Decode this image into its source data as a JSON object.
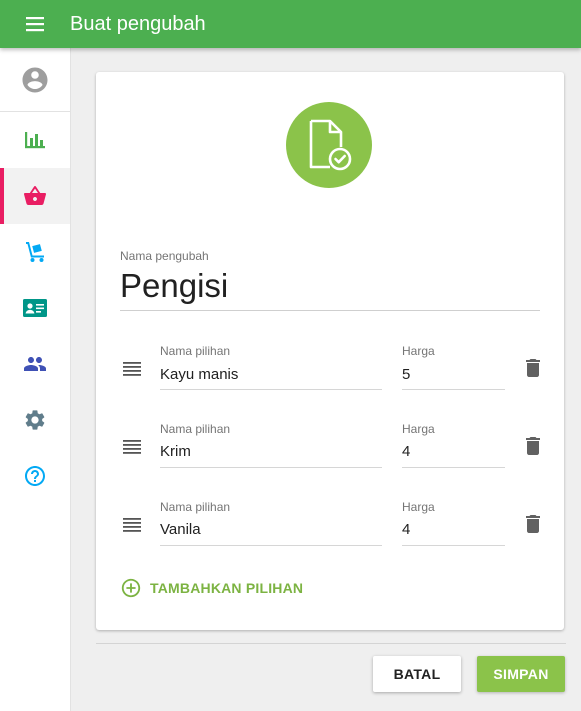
{
  "appbar": {
    "title": "Buat pengubah",
    "menu_icon": "hamburger-menu-icon"
  },
  "sidebar": {
    "items": [
      {
        "name": "account",
        "icon": "account-circle-icon",
        "color": "#9e9e9e"
      },
      {
        "name": "reports",
        "icon": "bar-chart-icon",
        "color": "#4caf50"
      },
      {
        "name": "items",
        "icon": "basket-icon",
        "color": "#e91e63",
        "active": true
      },
      {
        "name": "inventory",
        "icon": "dolly-icon",
        "color": "#03a9f4"
      },
      {
        "name": "customers",
        "icon": "id-card-icon",
        "color": "#009688"
      },
      {
        "name": "employees",
        "icon": "people-icon",
        "color": "#3f51b5"
      },
      {
        "name": "settings",
        "icon": "gear-icon",
        "color": "#607d8b"
      },
      {
        "name": "help",
        "icon": "help-circle-icon",
        "color": "#03a9f4"
      }
    ]
  },
  "form": {
    "hero_icon": "file-check-icon",
    "modifier_name_label": "Nama pengubah",
    "modifier_name_value": "Pengisi",
    "option_name_label": "Nama pilihan",
    "price_label": "Harga",
    "options": [
      {
        "name": "Kayu manis",
        "price": "5"
      },
      {
        "name": "Krim",
        "price": "4"
      },
      {
        "name": "Vanila",
        "price": "4"
      }
    ],
    "add_option_label": "TAMBAHKAN PILIHAN"
  },
  "actions": {
    "cancel_label": "BATAL",
    "save_label": "SIMPAN"
  },
  "colors": {
    "appbar": "#4caf50",
    "accent": "#8bc34a",
    "active_indicator": "#e91e63"
  }
}
